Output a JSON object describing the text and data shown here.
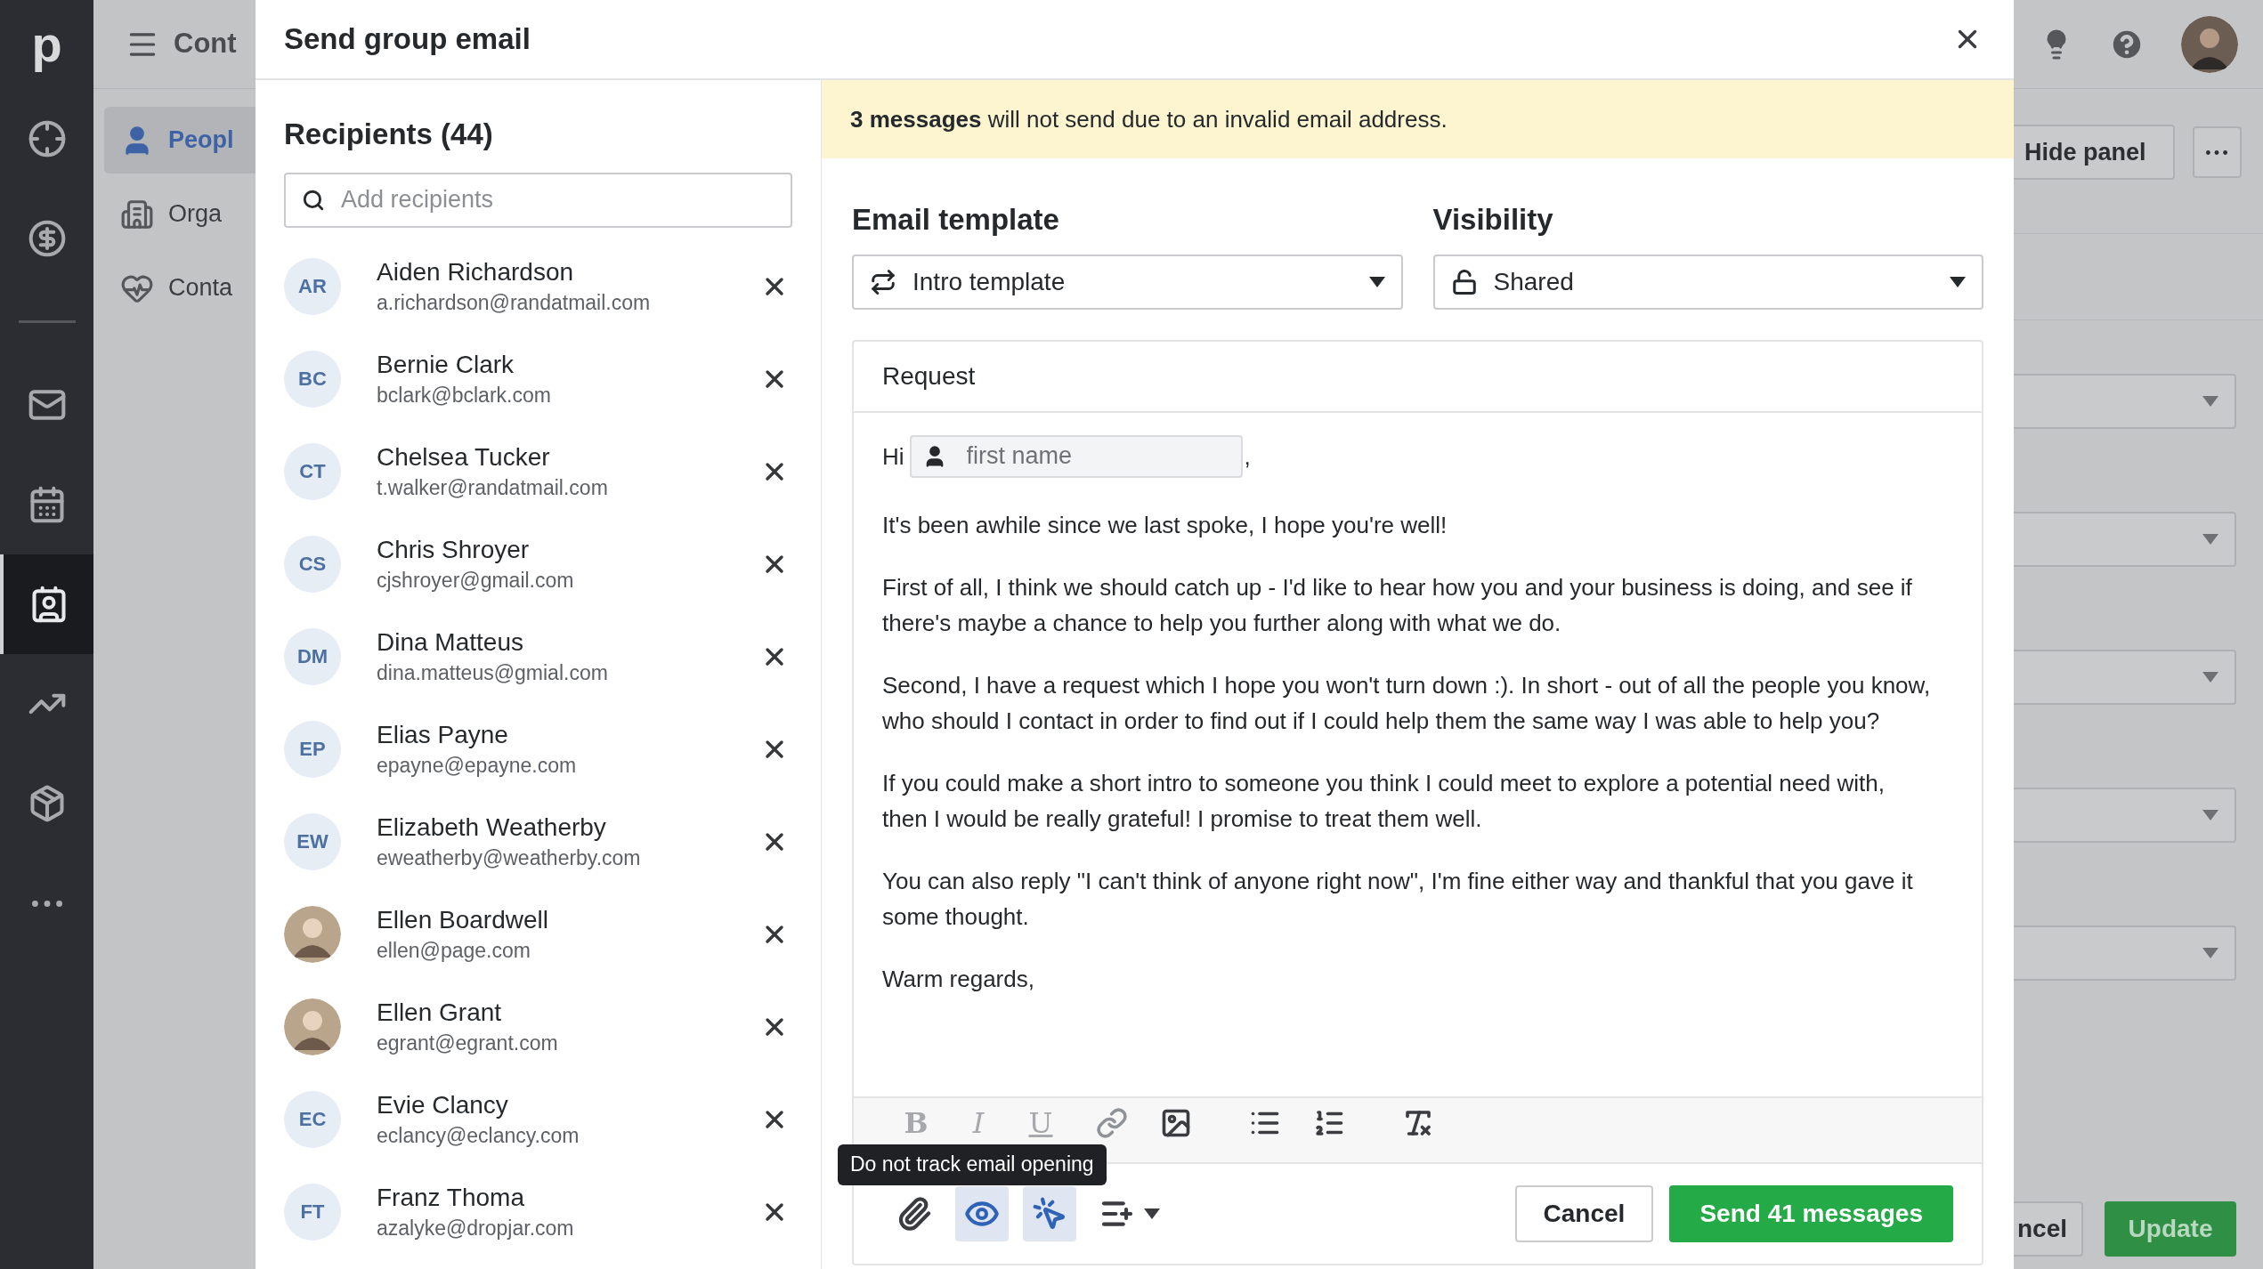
{
  "app_sidebar": {
    "logo": "p",
    "items": [
      {
        "selected": false
      },
      {
        "selected": false
      },
      {
        "selected": false
      },
      {
        "selected": false
      },
      {
        "selected": true
      },
      {
        "selected": false
      },
      {
        "selected": false
      },
      {
        "selected": false
      }
    ]
  },
  "contacts_panel": {
    "title": "Cont",
    "items": [
      {
        "label": "Peopl",
        "selected": true
      },
      {
        "label": "Orga",
        "selected": false
      },
      {
        "label": "Conta",
        "selected": false
      }
    ]
  },
  "modal": {
    "title": "Send group email",
    "recipients": {
      "title": "Recipients (44)",
      "search": {
        "placeholder": "Add recipients"
      },
      "items": [
        {
          "kind": "initials",
          "initials": "AR",
          "name": "Aiden Richardson",
          "email": "a.richardson@randatmail.com"
        },
        {
          "kind": "initials",
          "initials": "BC",
          "name": "Bernie Clark",
          "email": "bclark@bclark.com"
        },
        {
          "kind": "initials",
          "initials": "CT",
          "name": "Chelsea Tucker",
          "email": "t.walker@randatmail.com"
        },
        {
          "kind": "initials",
          "initials": "CS",
          "name": "Chris Shroyer",
          "email": "cjshroyer@gmail.com"
        },
        {
          "kind": "initials",
          "initials": "DM",
          "name": "Dina Matteus",
          "email": "dina.matteus@gmial.com"
        },
        {
          "kind": "initials",
          "initials": "EP",
          "name": "Elias Payne",
          "email": "epayne@epayne.com"
        },
        {
          "kind": "initials",
          "initials": "EW",
          "name": "Elizabeth Weatherby",
          "email": "eweatherby@weatherby.com"
        },
        {
          "kind": "photo",
          "name": "Ellen Boardwell",
          "email": "ellen@page.com"
        },
        {
          "kind": "photo",
          "name": "Ellen Grant",
          "email": "egrant@egrant.com"
        },
        {
          "kind": "initials",
          "initials": "EC",
          "name": "Evie Clancy",
          "email": "eclancy@eclancy.com"
        },
        {
          "kind": "initials",
          "initials": "FT",
          "name": "Franz Thoma",
          "email": "azalyke@dropjar.com"
        }
      ]
    },
    "banner": "**3 messages** will not send due to an invalid email address.",
    "template": {
      "label": "Email template",
      "value": "Intro template"
    },
    "visibility": {
      "label": "Visibility",
      "value": "Shared"
    },
    "editor": {
      "subject": "Request",
      "greeting": "Hi",
      "merge_field": {
        "placeholder": "first name"
      },
      "greeting_end": ",",
      "paragraphs": [
        "It's been awhile since we last spoke, I hope you're well!",
        "First of all, I think we should catch up - I'd like to hear how you and your business is doing, and see if there's maybe a chance to help you further along with what we do.",
        "Second, I have a request which I hope you won't turn down :). In short - out of all the people you know, who should I contact in order to find out if I could help them the same way I was able to help you?",
        "If you could make a short intro to someone you think I could meet to explore a potential need with, then I would be really grateful! I promise to treat them well.",
        "You can also reply \"I can't think of anyone right now\", I'm fine either way and thankful that you gave it some thought.",
        "Warm regards,"
      ],
      "format_buttons": [
        {
          "label": "B",
          "disabled": true
        },
        {
          "label": "I",
          "disabled": true
        },
        {
          "label": "U",
          "disabled": true
        }
      ],
      "tools": [
        {
          "kind": "link",
          "disabled": true
        },
        {
          "kind": "image",
          "disabled": false
        },
        {
          "kind": "bullets",
          "disabled": false
        },
        {
          "kind": "numbers",
          "disabled": false
        },
        {
          "kind": "clear",
          "disabled": false
        }
      ],
      "tracking": [
        {
          "kind": "attach",
          "on": false
        },
        {
          "kind": "open_tracking",
          "on": true
        },
        {
          "kind": "click_tracking",
          "on": true
        },
        {
          "kind": "merge_fields",
          "on": false
        }
      ],
      "tooltip": "Do not track email opening"
    },
    "buttons": {
      "cancel": "Cancel",
      "send": "Send 41 messages"
    }
  },
  "side_panel": {
    "hide_button": "Hide panel",
    "cancel_button": "ncel",
    "update_button": "Update"
  }
}
